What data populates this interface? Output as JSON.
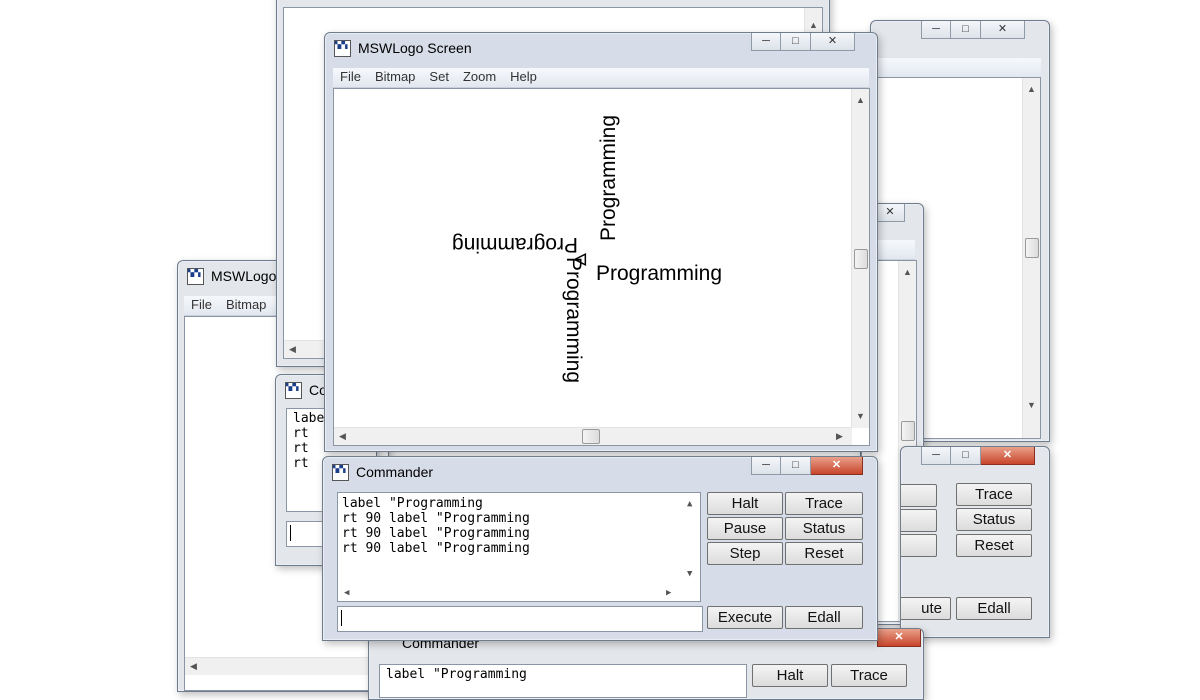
{
  "screen": {
    "title": "MSWLogo Screen",
    "menu": [
      "File",
      "Bitmap",
      "Set",
      "Zoom",
      "Help"
    ]
  },
  "commander": {
    "title": "Commander",
    "history": [
      "label \"Programming",
      "rt 90 label \"Programming",
      "rt 90 label \"Programming",
      "rt 90 label \"Programming"
    ],
    "buttons": {
      "halt": "Halt",
      "trace": "Trace",
      "pause": "Pause",
      "status": "Status",
      "step": "Step",
      "reset": "Reset",
      "execute": "Execute",
      "edall": "Edall"
    },
    "input_value": ""
  },
  "canvas": {
    "labels": [
      "Programming",
      "Programming",
      "Programming",
      "Programming"
    ],
    "turtle_glyph": "ᐊ"
  },
  "bg_left": {
    "title": "MSWLogo",
    "menu": [
      "File",
      "Bitmap"
    ]
  },
  "bg_right": {
    "trace": "Trace",
    "status": "Status",
    "reset": "Reset",
    "edall": "Edall",
    "execute_partial": "ute"
  },
  "bg_bottom": {
    "title_partial": "Commander",
    "line_partial": "label \"Programming",
    "halt": "Halt",
    "trace": "Trace"
  },
  "bg_mid": {
    "title_partial": "Co",
    "lines": [
      "labe",
      "rt",
      "rt",
      "rt"
    ]
  },
  "icons": {
    "minimize": "─",
    "maximize": "□",
    "close": "✕",
    "up": "▲",
    "down": "▼",
    "left": "◀",
    "right": "▶"
  }
}
